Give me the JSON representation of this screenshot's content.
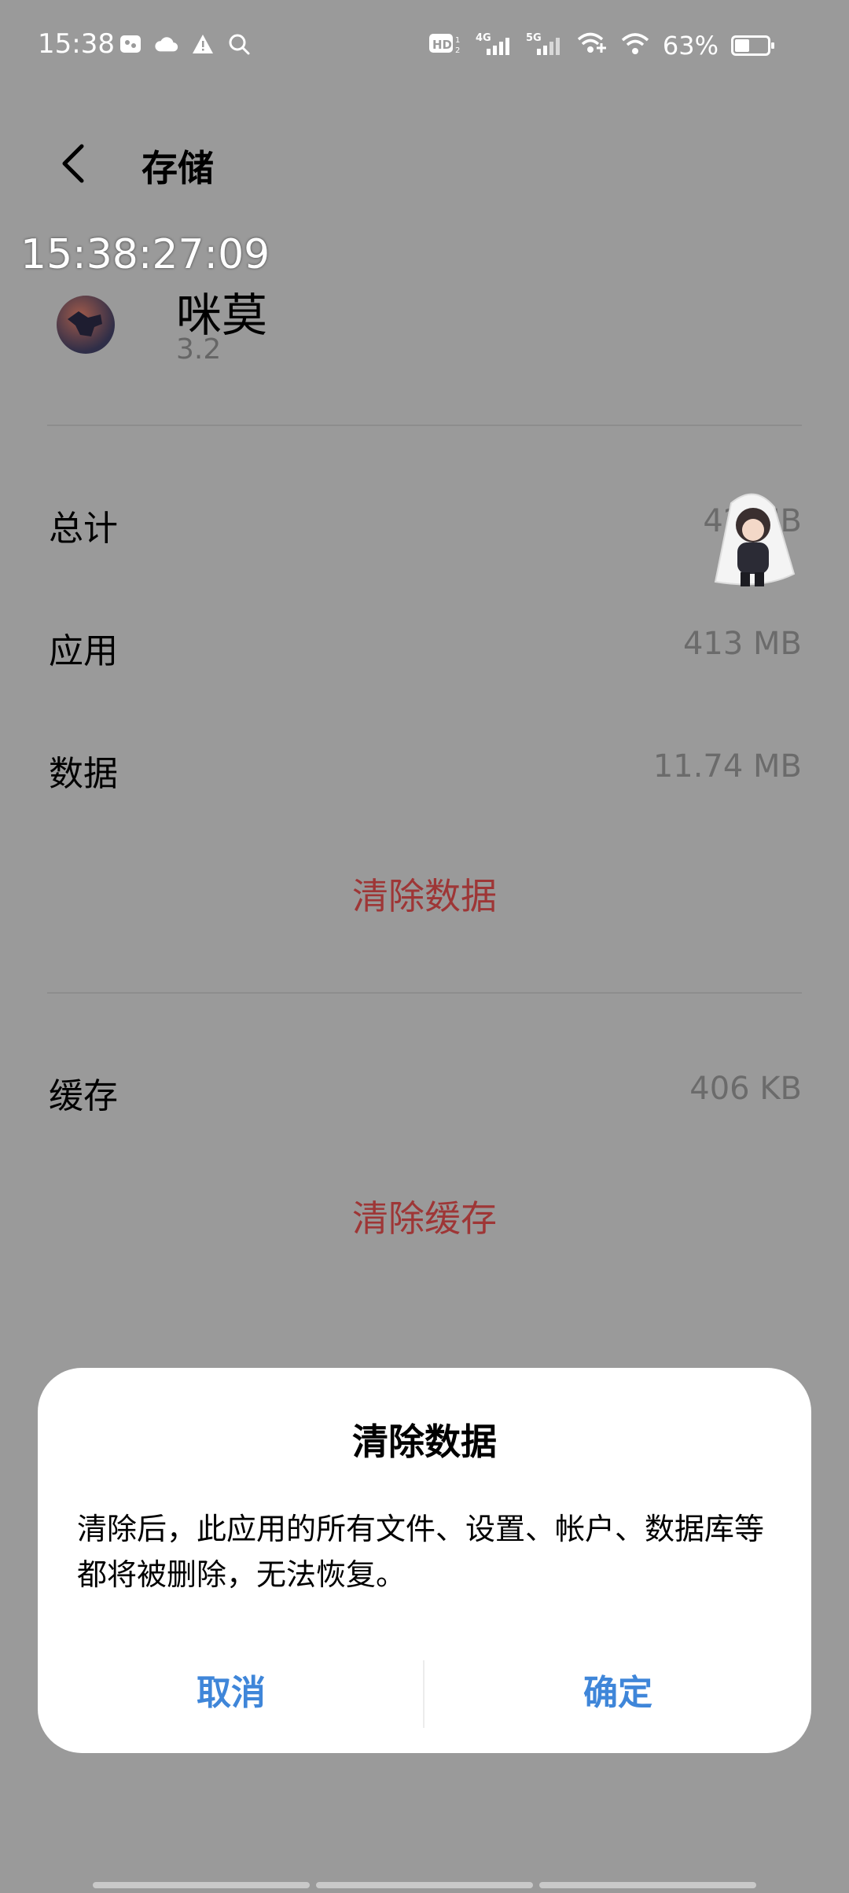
{
  "status_bar": {
    "time": "15:38",
    "battery": "63%",
    "icons_left": [
      "gallery-icon",
      "cloud-icon",
      "warning-icon",
      "search-icon"
    ],
    "icons_right": [
      "hd-icon",
      "signal-4g-icon",
      "signal-5g-icon",
      "wifi-hotspot-icon",
      "wifi-icon",
      "battery-icon"
    ],
    "battery_level": 0.63
  },
  "header": {
    "title": "存储"
  },
  "overlay": {
    "timestamp": "15:38:27:09"
  },
  "app": {
    "name": "咪莫",
    "version": "3.2"
  },
  "storage": {
    "total_label": "总计",
    "total_value": "42 MB",
    "app_label": "应用",
    "app_value": "413 MB",
    "data_label": "数据",
    "data_value": "11.74 MB",
    "clear_data_label": "清除数据",
    "cache_label": "缓存",
    "cache_value": "406 KB",
    "clear_cache_label": "清除缓存"
  },
  "dialog": {
    "title": "清除数据",
    "message": "清除后，此应用的所有文件、设置、帐户、数据库等都将被删除，无法恢复。",
    "cancel_label": "取消",
    "confirm_label": "确定"
  },
  "colors": {
    "accent_blue": "#3f86d9",
    "danger_red": "#9e3636",
    "scrim": "#9a9a9a"
  }
}
